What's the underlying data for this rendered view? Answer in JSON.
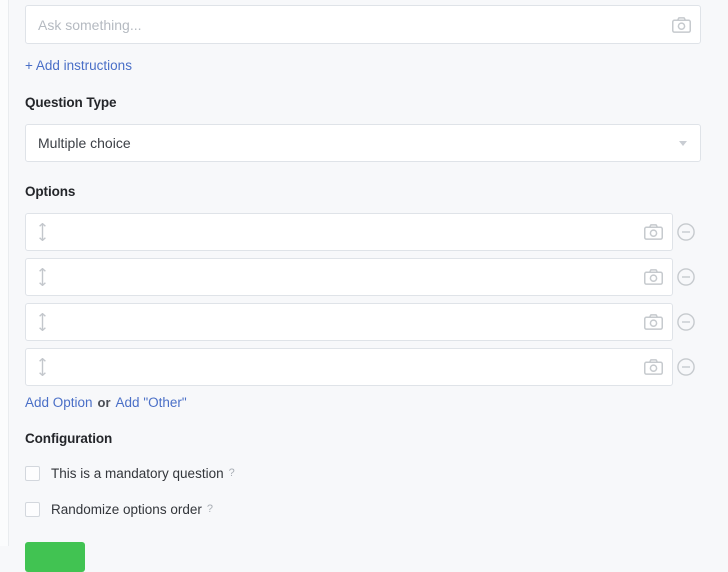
{
  "question_editor": {
    "ask": {
      "placeholder": "Ask something...",
      "value": "",
      "camera_icon": "camera-icon"
    },
    "add_instructions_label": "+ Add instructions",
    "question_type": {
      "label": "Question Type",
      "selected": "Multiple choice",
      "caret_icon": "chevron-down-icon"
    },
    "options": {
      "label": "Options",
      "rows": [
        {
          "value": "",
          "placeholder": "",
          "drag_icon": "drag-vertical-icon",
          "camera_icon": "camera-icon",
          "remove_icon": "minus-circle-icon"
        },
        {
          "value": "",
          "placeholder": "",
          "drag_icon": "drag-vertical-icon",
          "camera_icon": "camera-icon",
          "remove_icon": "minus-circle-icon"
        },
        {
          "value": "",
          "placeholder": "",
          "drag_icon": "drag-vertical-icon",
          "camera_icon": "camera-icon",
          "remove_icon": "minus-circle-icon"
        },
        {
          "value": "",
          "placeholder": "",
          "drag_icon": "drag-vertical-icon",
          "camera_icon": "camera-icon",
          "remove_icon": "minus-circle-icon"
        }
      ],
      "add_option_label": "Add Option",
      "or_label": "or",
      "add_other_label": "Add \"Other\""
    },
    "configuration": {
      "label": "Configuration",
      "items": [
        {
          "label": "This is a mandatory question",
          "checked": false,
          "help": "?"
        },
        {
          "label": "Randomize options order",
          "checked": false,
          "help": "?"
        }
      ]
    },
    "save_label": ""
  },
  "colors": {
    "link": "#4a6fc7",
    "save_green": "#41c352",
    "page_bg": "#f7f8fa",
    "field_border": "#dfe3e8",
    "placeholder": "#b5bac1"
  }
}
